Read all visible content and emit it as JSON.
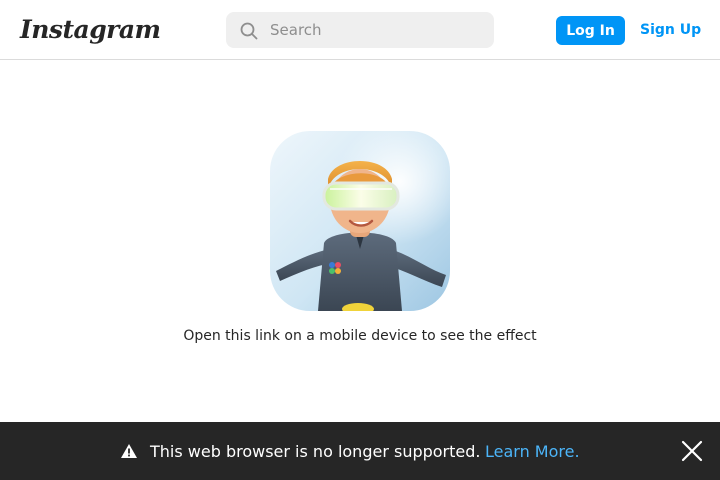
{
  "header": {
    "logo_text": "Instagram",
    "search": {
      "placeholder": "Search",
      "icon": "search-icon"
    },
    "login_label": "Log In",
    "signup_label": "Sign Up",
    "colors": {
      "accent": "#0095f6"
    }
  },
  "main": {
    "effect_image": "effect-preview-avatar",
    "caption": "Open this link on a mobile device to see the effect"
  },
  "banner": {
    "warning_icon": "warning-icon",
    "message": "This web browser is no longer supported.",
    "link_label": "Learn More.",
    "close_icon": "close-icon",
    "colors": {
      "background": "#262626",
      "link": "#4cb5f9"
    }
  }
}
